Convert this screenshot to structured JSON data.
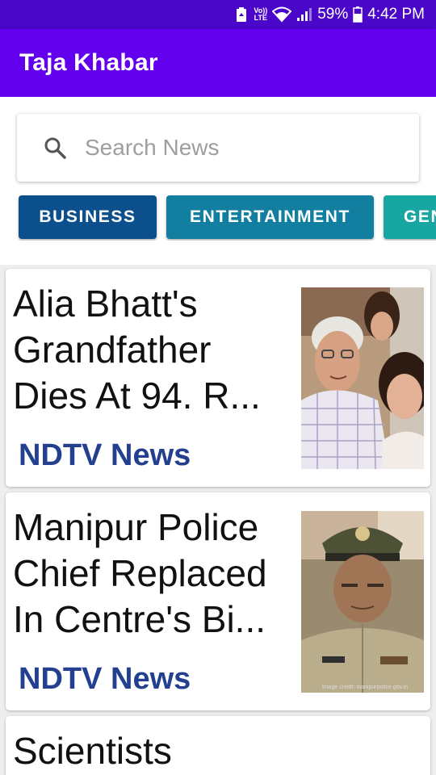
{
  "status_bar": {
    "battery": "59%",
    "time": "4:42 PM",
    "volte_top": "Vo))",
    "volte_bottom": "LTE"
  },
  "app_bar": {
    "title": "Taja Khabar"
  },
  "search": {
    "placeholder": "Search News",
    "value": ""
  },
  "categories": [
    "BUSINESS",
    "ENTERTAINMENT",
    "GEN"
  ],
  "news": [
    {
      "headline": "Alia Bhatt's Grandfather Dies At 94. R...",
      "source": "NDTV News"
    },
    {
      "headline": "Manipur Police Chief Replaced In Centre's Bi...",
      "source": "NDTV News",
      "image_credit": "Image credit: manipurpolice.gov.in"
    },
    {
      "headline": "Scientists",
      "source": ""
    }
  ],
  "colors": {
    "status_bar": "#4a07c9",
    "app_bar": "#6200ee",
    "source_text": "#233f8f",
    "chip_business": "#0b4f8c",
    "chip_entertainment": "#127ea0",
    "chip_general": "#18a6a3"
  }
}
